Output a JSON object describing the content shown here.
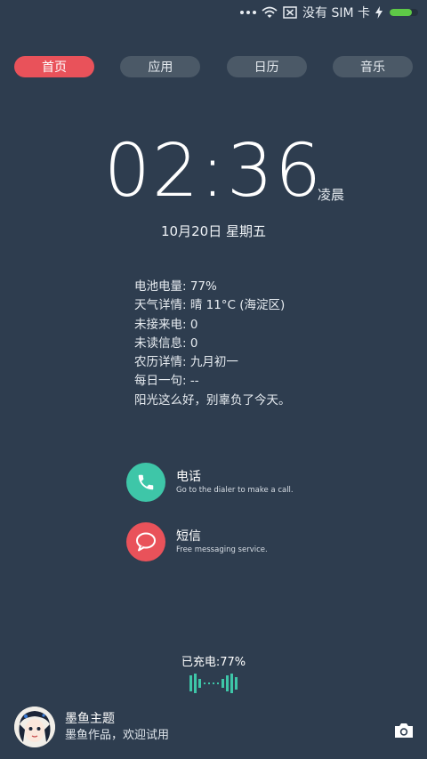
{
  "status_bar": {
    "sim_text": "没有 SIM 卡",
    "battery_level": 0.77
  },
  "tabs": [
    {
      "label": "首页",
      "active": true
    },
    {
      "label": "应用",
      "active": false
    },
    {
      "label": "日历",
      "active": false
    },
    {
      "label": "音乐",
      "active": false
    }
  ],
  "clock": {
    "time": "02:36",
    "period": "凌晨",
    "date": "10月20日  星期五"
  },
  "info_lines": [
    "电池电量: 77%",
    "天气详情: 晴 11°C (海淀区)",
    "未接来电: 0",
    "未读信息: 0",
    "农历详情: 九月初一",
    "每日一句: --",
    "阳光这么好，别辜负了今天。"
  ],
  "actions": {
    "phone": {
      "title": "电话",
      "subtitle": "Go to the dialer to make a call.",
      "color": "#3ec6a8"
    },
    "sms": {
      "title": "短信",
      "subtitle": "Free messaging service.",
      "color": "#e9525a"
    }
  },
  "charging": {
    "text": "已充电:77%",
    "color": "#3ec6a8"
  },
  "theme": {
    "title": "墨鱼主题",
    "subtitle": "墨鱼作品，欢迎试用"
  },
  "colors": {
    "accent": "#e9525a",
    "background": "#2e3d4f",
    "tab_inactive": "#4b5967"
  }
}
